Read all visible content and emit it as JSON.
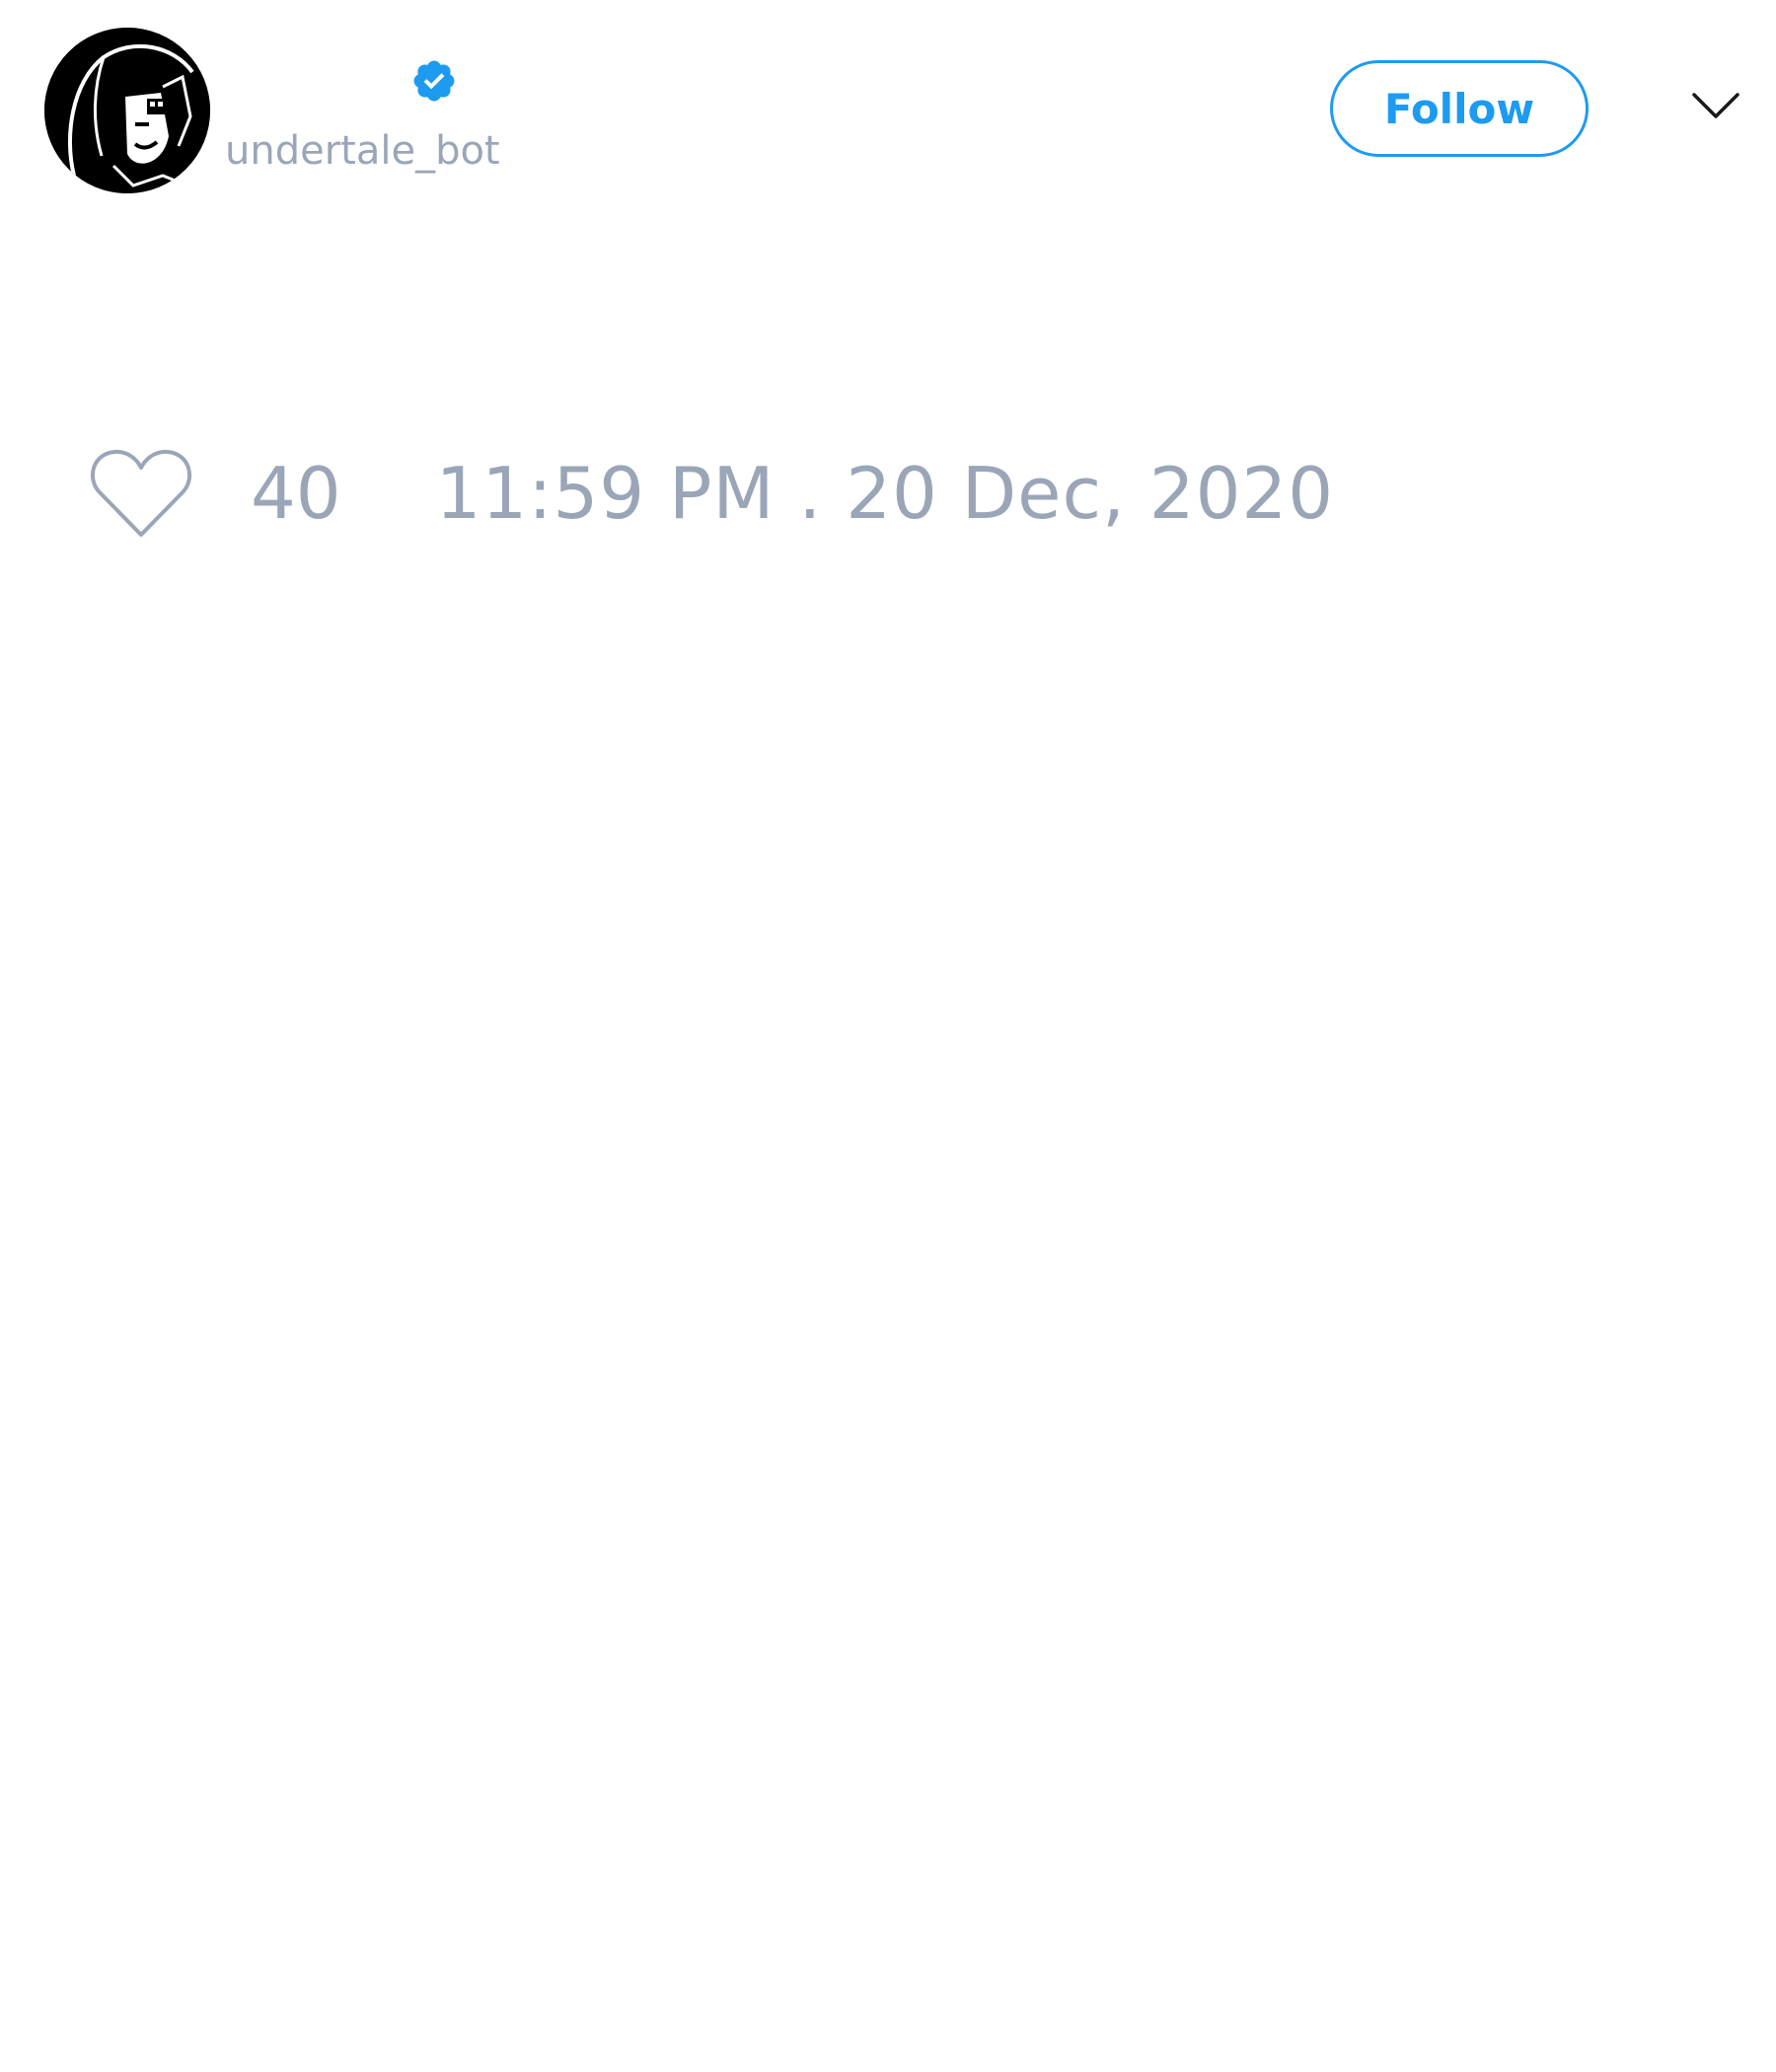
{
  "author": {
    "handle": "undertale_bot",
    "verified": true,
    "avatar_icon": "pixel-character-avatar"
  },
  "header": {
    "follow_label": "Follow",
    "menu_icon": "chevron-down-icon"
  },
  "stats": {
    "like_icon": "heart-outline-icon",
    "like_count": "40",
    "timestamp": "11:59 PM . 20 Dec, 2020"
  },
  "colors": {
    "accent": "#1d9bf0",
    "muted_text": "#9aa6b8",
    "background": "#ffffff"
  }
}
